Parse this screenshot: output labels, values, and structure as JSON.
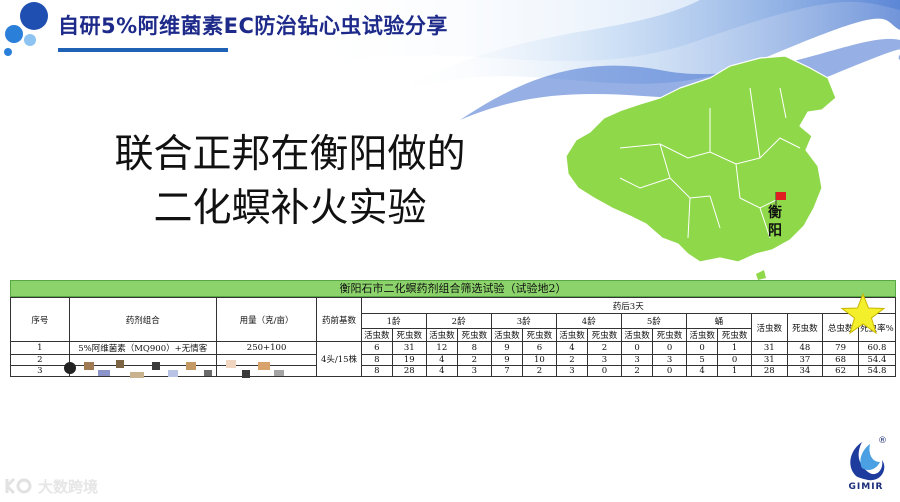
{
  "header": {
    "title": "自研5%阿维菌素EC防治钻心虫试验分享"
  },
  "main_text": {
    "line1": "联合正邦在衡阳做的",
    "line2": "二化螟补火实验"
  },
  "map": {
    "city_label": "衡阳",
    "fill_color": "#8fd84a",
    "flag_color": "#e02020"
  },
  "table": {
    "title": "衡阳石市二化螟药剂组合筛选试验（试验地2）",
    "headers": {
      "index": "序号",
      "pesticide": "药剂组合",
      "dosage": "用量（克/亩）",
      "base": "药前基数",
      "after": "药后3天",
      "instars": [
        "1龄",
        "2龄",
        "3龄",
        "4龄",
        "5龄",
        "蛹"
      ],
      "alive": "活虫数",
      "dead": "死虫数",
      "total": "总虫数",
      "rate": "死虫率%"
    },
    "rows": [
      {
        "index": "1",
        "pesticide": "5%阿维菌素（MQ900）+无情客",
        "dosage": "250+100",
        "values": [
          "6",
          "31",
          "12",
          "8",
          "9",
          "6",
          "4",
          "2",
          "0",
          "0",
          "0",
          "1",
          "31",
          "48",
          "79",
          "60.8"
        ]
      },
      {
        "index": "2",
        "pesticide": "",
        "dosage": "",
        "values": [
          "8",
          "19",
          "4",
          "2",
          "9",
          "10",
          "2",
          "3",
          "3",
          "3",
          "5",
          "0",
          "31",
          "37",
          "68",
          "54.4"
        ]
      },
      {
        "index": "3",
        "pesticide": "",
        "dosage": "",
        "values": [
          "8",
          "28",
          "4",
          "3",
          "7",
          "2",
          "3",
          "0",
          "2",
          "0",
          "4",
          "1",
          "28",
          "34",
          "62",
          "54.8"
        ]
      }
    ],
    "base_value": "4头/15株"
  },
  "watermark": {
    "text": "大数跨境"
  },
  "logo": {
    "text": "GIMIR",
    "mark": "®"
  }
}
